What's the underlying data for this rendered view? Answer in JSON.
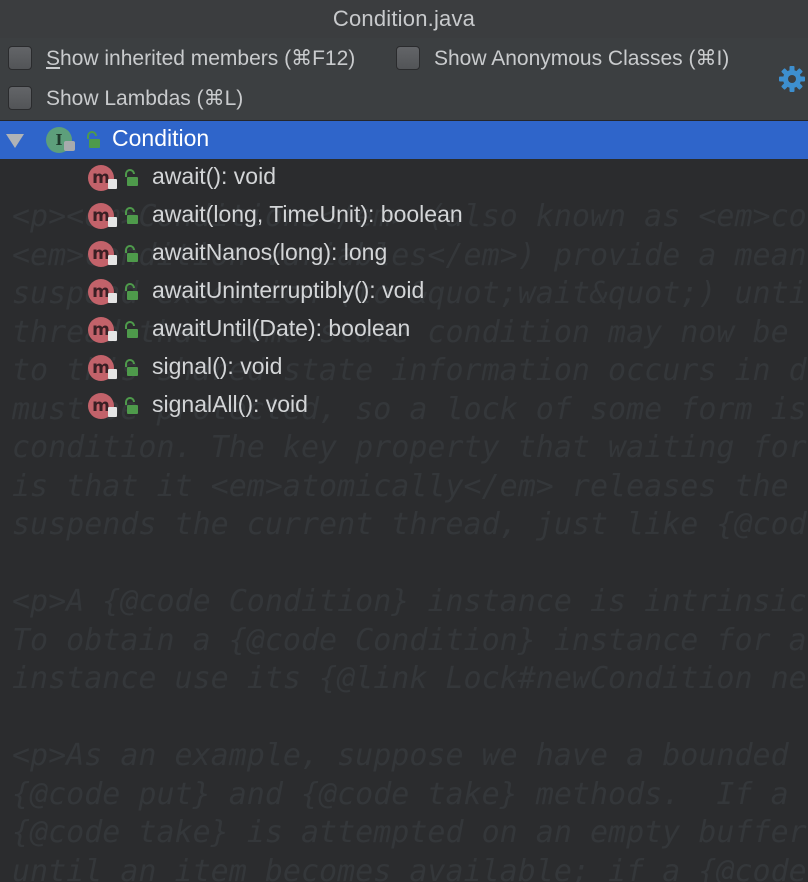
{
  "window": {
    "title": "Condition.java"
  },
  "options": {
    "show_inherited": {
      "prefix": "",
      "underline": "S",
      "rest": "how inherited members (⌘F12)",
      "checked": false
    },
    "show_anonymous": {
      "label": "Show Anonymous Classes (⌘I)",
      "checked": false
    },
    "show_lambdas": {
      "label": "Show Lambdas (⌘L)",
      "checked": false
    },
    "settings_icon": "gear-icon"
  },
  "tree": {
    "root": {
      "label": "Condition",
      "icon": "interface-icon",
      "visibility": "public",
      "expanded": true,
      "selected": true
    },
    "members": [
      {
        "label": "await(): void",
        "icon": "method-icon",
        "visibility": "public"
      },
      {
        "label": "await(long, TimeUnit): boolean",
        "icon": "method-icon",
        "visibility": "public"
      },
      {
        "label": "awaitNanos(long): long",
        "icon": "method-icon",
        "visibility": "public"
      },
      {
        "label": "awaitUninterruptibly(): void",
        "icon": "method-icon",
        "visibility": "public"
      },
      {
        "label": "awaitUntil(Date): boolean",
        "icon": "method-icon",
        "visibility": "public"
      },
      {
        "label": "signal(): void",
        "icon": "method-icon",
        "visibility": "public"
      },
      {
        "label": "signalAll(): void",
        "icon": "method-icon",
        "visibility": "public"
      }
    ]
  },
  "background_code": [
    "",
    "",
    "<p><em>Conditions</em> (also known as <em>conditio",
    "<em>condition variables</em>) provide a means",
    "suspend execution (to &quot;wait&quot;) until",
    "thread that some state condition may now be",
    "to this shared state information occurs in d",
    "must be protected, so a lock of some form is",
    "condition. The key property that waiting for",
    "is that it <em>atomically</em> releases the",
    "suspends the current thread, just like {@code",
    "",
    "<p>A {@code Condition} instance is intrinsic",
    "To obtain a {@code Condition} instance for a",
    "instance use its {@link Lock#newCondition new",
    "",
    "<p>As an example, suppose we have a bounded",
    "{@code put} and {@code take} methods.  If a",
    "{@code take} is attempted on an empty buffer",
    "until an item becomes available; if a {@code"
  ],
  "colors": {
    "selection": "#2f65ca",
    "interface_icon": "#5d9f7b",
    "method_icon": "#c2626a",
    "public_lock": "#4e9a4b",
    "gear": "#3d8fcf"
  }
}
